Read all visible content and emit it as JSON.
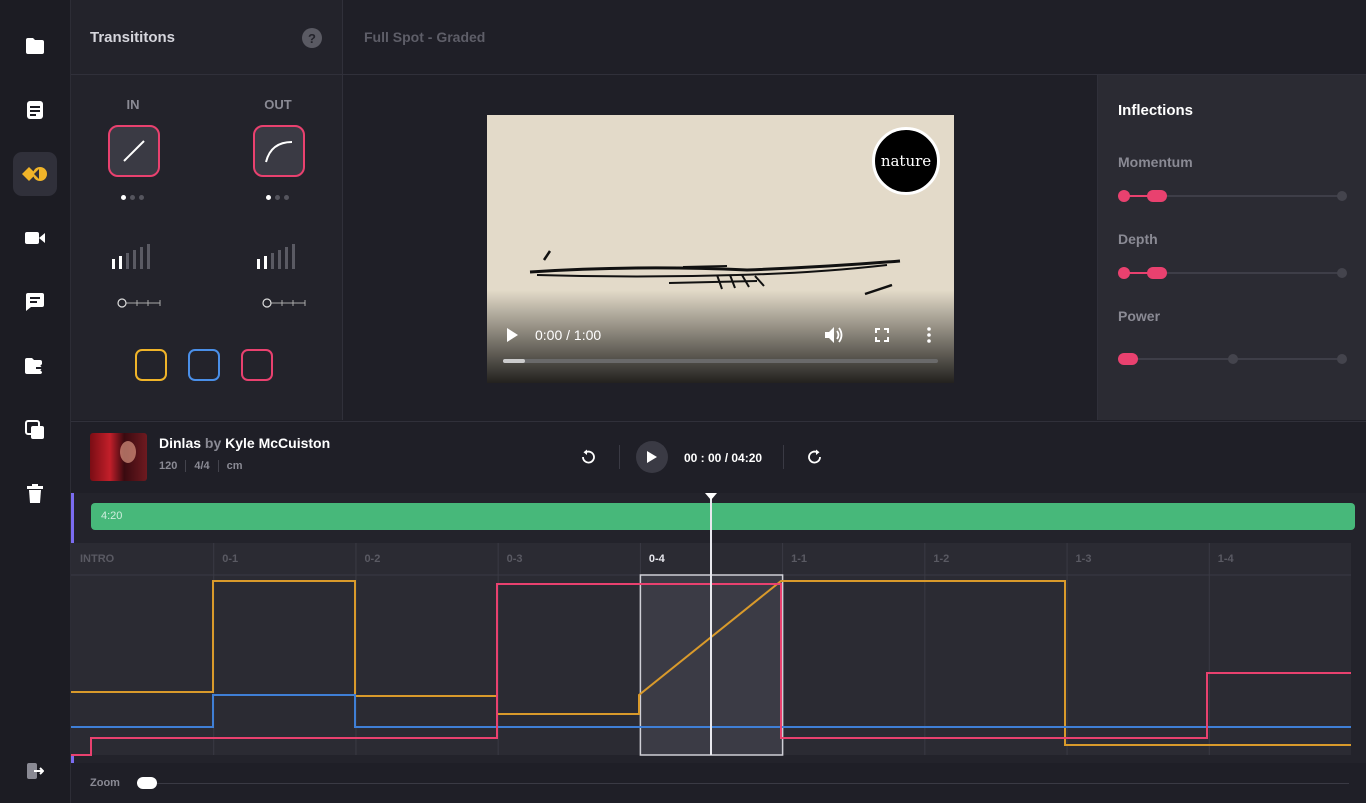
{
  "sidebar": {
    "icons": [
      {
        "name": "folder-icon",
        "active": false
      },
      {
        "name": "document-icon",
        "active": false
      },
      {
        "name": "transitions-icon",
        "active": true
      },
      {
        "name": "video-camera-icon",
        "active": false
      },
      {
        "name": "comment-icon",
        "active": false
      },
      {
        "name": "folder-share-icon",
        "active": false
      },
      {
        "name": "duplicate-icon",
        "active": false
      },
      {
        "name": "trash-icon",
        "active": false
      }
    ],
    "logout_icon": "logout-icon"
  },
  "transitions": {
    "title": "Transititons",
    "help_label": "?",
    "in_label": "IN",
    "out_label": "OUT",
    "colors": [
      "#f0b429",
      "#4a8fe8",
      "#e9416f"
    ]
  },
  "header": {
    "project_title": "Full Spot - Graded"
  },
  "video": {
    "time_label": "0:00 / 1:00",
    "logo_text": "nature",
    "progress": 0.05
  },
  "inflections": {
    "title": "Inflections",
    "sliders": [
      {
        "label": "Momentum",
        "value": 0.12
      },
      {
        "label": "Depth",
        "value": 0.12
      },
      {
        "label": "Power",
        "value": 0.0
      }
    ]
  },
  "track": {
    "title": "Dinlas",
    "by": "by",
    "artist": "Kyle McCuiston",
    "bpm": "120",
    "time_signature": "4/4",
    "key": "cm",
    "time_display": "00 : 00 / 04:20"
  },
  "timeline": {
    "duration_label": "4:20",
    "sections": [
      "INTRO",
      "0-1",
      "0-2",
      "0-3",
      "0-4",
      "1-1",
      "1-2",
      "1-3",
      "1-4"
    ],
    "active_section": 4,
    "playhead": 0.4
  },
  "zoom": {
    "label": "Zoom",
    "value": 0.0
  },
  "colors": {
    "accent_pink": "#e9416f",
    "accent_yellow": "#d99a2b",
    "accent_blue": "#3f7fd6",
    "accent_green": "#47b87a"
  }
}
